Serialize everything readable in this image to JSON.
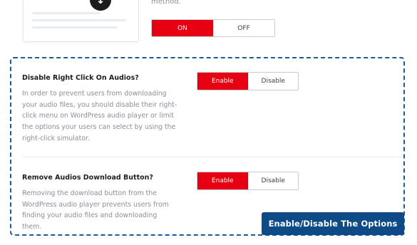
{
  "top": {
    "method_text": "method.",
    "toggle": {
      "on_label": "ON",
      "off_label": "OFF",
      "selected": "ON"
    }
  },
  "settings": [
    {
      "title": "Disable Right Click On Audios?",
      "description_lines": [
        "In order to prevent users from downloading",
        "your audio files, you should disable their right-",
        "click menu on WordPress audio player or limit",
        "the options your users can select by using the",
        "right-click simulator."
      ],
      "enable_label": "Enable",
      "disable_label": "Disable",
      "selected": "Enable"
    },
    {
      "title": "Remove Audios Download Button?",
      "description_lines": [
        "Removing the download button from the",
        "WordPress audio player prevents users from",
        "finding your audio files and downloading",
        "them."
      ],
      "enable_label": "Enable",
      "disable_label": "Disable",
      "selected": "Enable"
    }
  ],
  "callout": "Enable/Disable The Options",
  "colors": {
    "accent": "#e60012",
    "callout_bg": "#0d4a86",
    "dashed_border": "#1e5a96"
  }
}
